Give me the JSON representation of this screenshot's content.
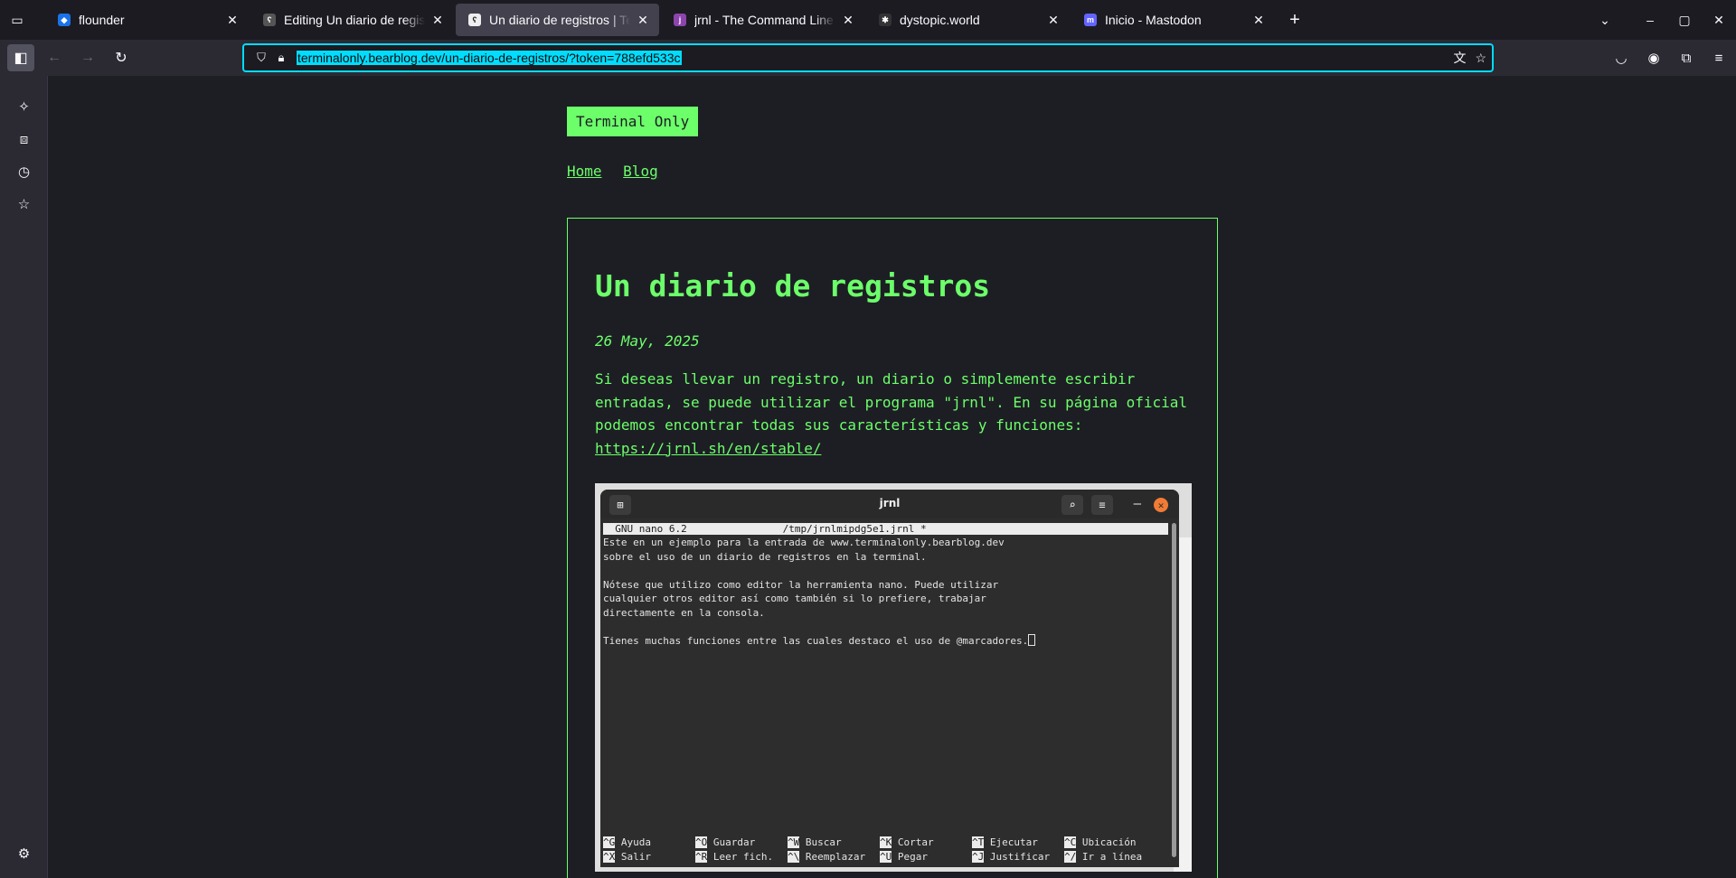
{
  "browser": {
    "tabs": [
      {
        "title": "flounder",
        "favicon_color": "#1a73e8",
        "active": false
      },
      {
        "title": "Editing Un diario de registros",
        "favicon_color": "#444444",
        "active": false
      },
      {
        "title": "Un diario de registros | Terminal Only",
        "favicon_color": "#ffffff",
        "active": true
      },
      {
        "title": "jrnl - The Command Line Journal",
        "favicon_color": "#8e44ad",
        "active": false
      },
      {
        "title": "dystopic.world",
        "favicon_color": "#333333",
        "active": false
      },
      {
        "title": "Inicio - Mastodon",
        "favicon_color": "#6364ff",
        "active": false
      }
    ],
    "url": "terminalonly.bearblog.dev/un-diario-de-registros/?token=788efd533c"
  },
  "site": {
    "title": "Terminal Only",
    "nav": [
      "Home",
      "Blog"
    ]
  },
  "post": {
    "title": "Un diario de registros",
    "date": "26 May, 2025",
    "paragraph": "Si deseas llevar un registro, un diario o simplemente escribir entradas, se puede utilizar el programa \"jrnl\". En su página oficial podemos encontrar todas sus características y funciones: ",
    "link": "https://jrnl.sh/en/stable/"
  },
  "terminal": {
    "window_title": "jrnl",
    "nano_header": "  GNU nano 6.2                /tmp/jrnlmipdg5e1.jrnl *",
    "lines": [
      "Este en un ejemplo para la entrada de www.terminalonly.bearblog.dev",
      "sobre el uso de un diario de registros en la terminal.",
      "",
      "Nótese que utilizo como editor la herramienta nano. Puede utilizar",
      "cualquier otros editor así como también si lo prefiere, trabajar",
      "directamente en la consola.",
      "",
      "Tienes muchas funciones entre las cuales destaco el uso de @marcadores."
    ],
    "shortcuts_row1": [
      {
        "key": "^G",
        "label": "Ayuda"
      },
      {
        "key": "^O",
        "label": "Guardar"
      },
      {
        "key": "^W",
        "label": "Buscar"
      },
      {
        "key": "^K",
        "label": "Cortar"
      },
      {
        "key": "^T",
        "label": "Ejecutar"
      },
      {
        "key": "^C",
        "label": "Ubicación"
      }
    ],
    "shortcuts_row2": [
      {
        "key": "^X",
        "label": "Salir"
      },
      {
        "key": "^R",
        "label": "Leer fich."
      },
      {
        "key": "^\\",
        "label": "Reemplazar"
      },
      {
        "key": "^U",
        "label": "Pegar"
      },
      {
        "key": "^J",
        "label": "Justificar"
      },
      {
        "key": "^/",
        "label": "Ir a línea"
      }
    ]
  }
}
